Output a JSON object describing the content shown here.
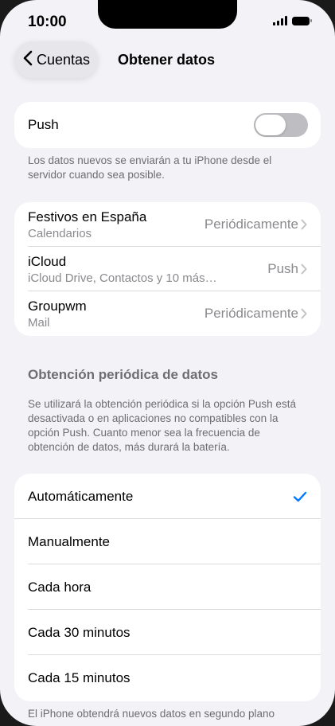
{
  "status": {
    "time": "10:00"
  },
  "nav": {
    "back_label": "Cuentas",
    "title": "Obtener datos"
  },
  "push": {
    "label": "Push",
    "enabled": false,
    "note": "Los datos nuevos se enviarán a tu iPhone desde el servidor cuando sea posible."
  },
  "accounts": [
    {
      "name": "Festivos en España",
      "type": "Calendarios",
      "value": "Periódicamente"
    },
    {
      "name": "iCloud",
      "type": "iCloud Drive, Contactos y 10 más…",
      "value": "Push"
    },
    {
      "name": "Groupwm",
      "type": "Mail",
      "value": "Periódicamente"
    }
  ],
  "fetch": {
    "title": "Obtención periódica de datos",
    "note": "Se utilizará la obtención periódica si la opción Push está desactivada o en aplicaciones no compatibles con la opción Push. Cuanto menor sea la frecuencia de obtención de datos, más durará la batería.",
    "options": [
      "Automáticamente",
      "Manualmente",
      "Cada hora",
      "Cada 30 minutos",
      "Cada 15 minutos"
    ],
    "selected": "Automáticamente",
    "footer": "El iPhone obtendrá nuevos datos en segundo plano"
  },
  "colors": {
    "accent": "#007aff",
    "background": "#f2f2f7"
  }
}
